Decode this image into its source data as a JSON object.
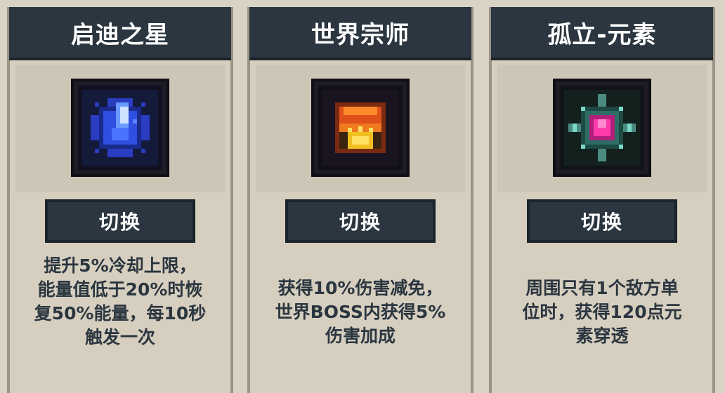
{
  "cards": [
    {
      "title": "启迪之星",
      "icon": "blue-star-crystal-icon",
      "button_label": "切换",
      "description": "提升5%冷却上限，\n能量值低于20%时恢\n复50%能量，每10秒\n触发一次"
    },
    {
      "title": "世界宗师",
      "icon": "golden-crown-icon",
      "button_label": "切换",
      "description": "获得10%伤害减免，\n世界BOSS内获得5%\n伤害加成"
    },
    {
      "title": "孤立-元素",
      "icon": "pink-element-gem-icon",
      "button_label": "切换",
      "description": "周围只有1个敌方单\n位时，获得120点元\n素穿透"
    }
  ],
  "colors": {
    "panel_dark": "#2b3640",
    "panel_light": "#d6cfbf",
    "text_dark": "#2b3640",
    "text_light": "#ffffff"
  }
}
